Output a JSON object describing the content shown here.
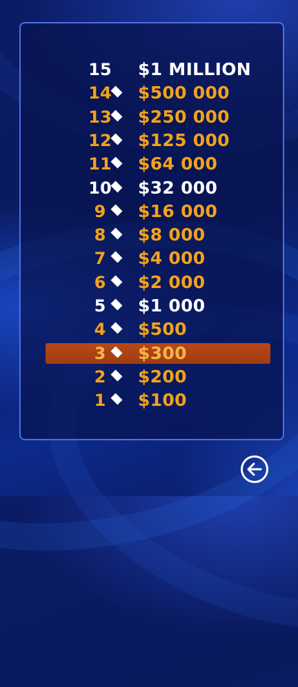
{
  "ladder": {
    "current_level": 3,
    "rows": [
      {
        "level": "15",
        "amount": "$1 MILLION",
        "milestone": true,
        "diamond": false
      },
      {
        "level": "14",
        "amount": "$500 000",
        "milestone": false,
        "diamond": true
      },
      {
        "level": "13",
        "amount": "$250 000",
        "milestone": false,
        "diamond": true
      },
      {
        "level": "12",
        "amount": "$125 000",
        "milestone": false,
        "diamond": true
      },
      {
        "level": "11",
        "amount": "$64 000",
        "milestone": false,
        "diamond": true
      },
      {
        "level": "10",
        "amount": "$32 000",
        "milestone": true,
        "diamond": true
      },
      {
        "level": "9",
        "amount": "$16 000",
        "milestone": false,
        "diamond": true
      },
      {
        "level": "8",
        "amount": "$8 000",
        "milestone": false,
        "diamond": true
      },
      {
        "level": "7",
        "amount": "$4 000",
        "milestone": false,
        "diamond": true
      },
      {
        "level": "6",
        "amount": "$2 000",
        "milestone": false,
        "diamond": true
      },
      {
        "level": "5",
        "amount": "$1 000",
        "milestone": true,
        "diamond": true
      },
      {
        "level": "4",
        "amount": "$500",
        "milestone": false,
        "diamond": true
      },
      {
        "level": "3",
        "amount": "$300",
        "milestone": false,
        "diamond": true
      },
      {
        "level": "2",
        "amount": "$200",
        "milestone": false,
        "diamond": true
      },
      {
        "level": "1",
        "amount": "$100",
        "milestone": false,
        "diamond": true
      }
    ]
  },
  "colors": {
    "gold": "#f2a21c",
    "milestone": "#ffffff",
    "highlight": "#b84818",
    "panel_border": "#4f6fe0"
  },
  "back_button": {
    "icon": "arrow-left-icon"
  }
}
